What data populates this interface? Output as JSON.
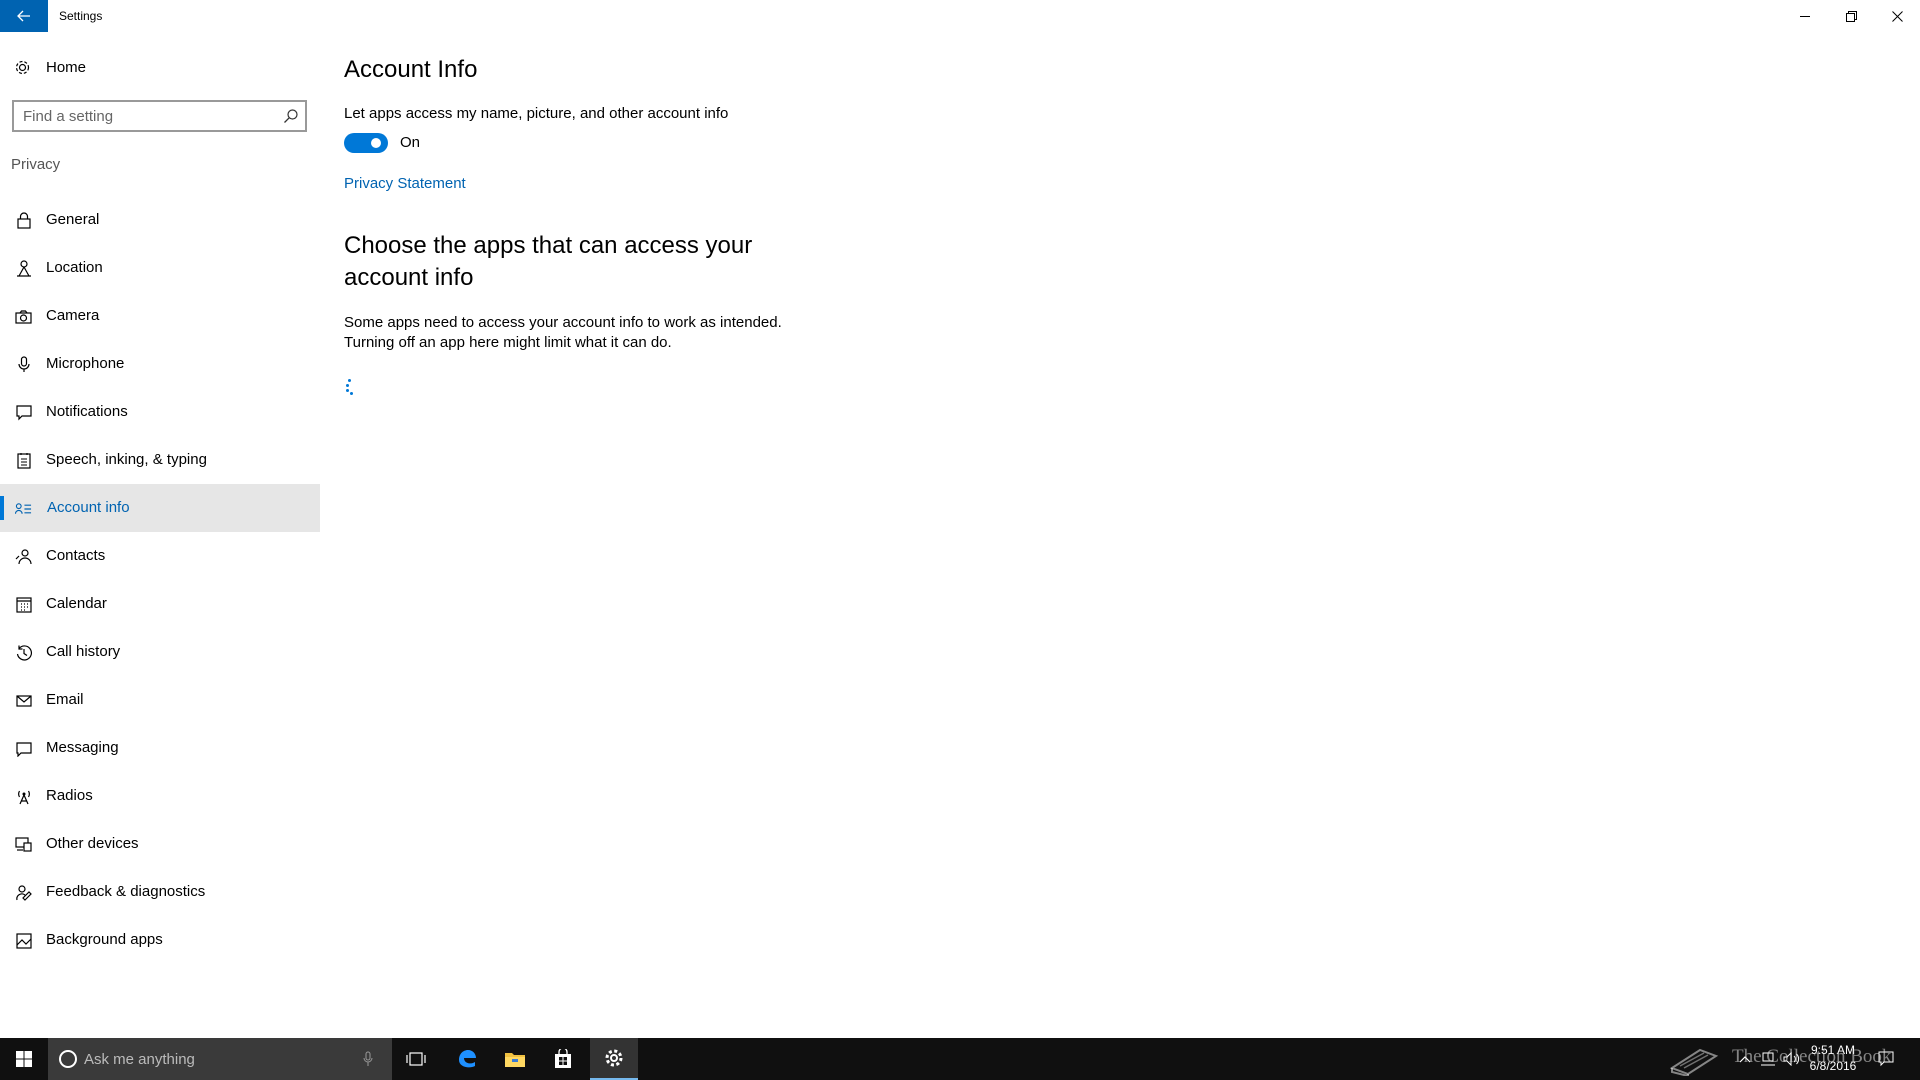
{
  "window": {
    "title": "Settings",
    "controls": {
      "minimize": "minimize",
      "maximize": "restore",
      "close": "close"
    }
  },
  "sidebar": {
    "home_label": "Home",
    "search": {
      "placeholder": "Find a setting"
    },
    "section_label": "Privacy",
    "items": [
      {
        "label": "General",
        "icon": "lock-icon",
        "selected": false
      },
      {
        "label": "Location",
        "icon": "location-icon",
        "selected": false
      },
      {
        "label": "Camera",
        "icon": "camera-icon",
        "selected": false
      },
      {
        "label": "Microphone",
        "icon": "microphone-icon",
        "selected": false
      },
      {
        "label": "Notifications",
        "icon": "notifications-icon",
        "selected": false
      },
      {
        "label": "Speech, inking, & typing",
        "icon": "speech-icon",
        "selected": false
      },
      {
        "label": "Account info",
        "icon": "account-info-icon",
        "selected": true
      },
      {
        "label": "Contacts",
        "icon": "contacts-icon",
        "selected": false
      },
      {
        "label": "Calendar",
        "icon": "calendar-icon",
        "selected": false
      },
      {
        "label": "Call history",
        "icon": "call-history-icon",
        "selected": false
      },
      {
        "label": "Email",
        "icon": "email-icon",
        "selected": false
      },
      {
        "label": "Messaging",
        "icon": "messaging-icon",
        "selected": false
      },
      {
        "label": "Radios",
        "icon": "radios-icon",
        "selected": false
      },
      {
        "label": "Other devices",
        "icon": "other-devices-icon",
        "selected": false
      },
      {
        "label": "Feedback & diagnostics",
        "icon": "feedback-icon",
        "selected": false
      },
      {
        "label": "Background apps",
        "icon": "background-apps-icon",
        "selected": false
      }
    ]
  },
  "main": {
    "title": "Account Info",
    "setting_description": "Let apps access my name, picture, and other account info",
    "toggle": {
      "on": true,
      "state_label": "On"
    },
    "privacy_link": "Privacy Statement",
    "apps_heading": "Choose the apps that can access your account info",
    "apps_description": "Some apps need to access your account info to work as intended. Turning off an app here might limit what it can do."
  },
  "taskbar": {
    "search_placeholder": "Ask me anything",
    "pinned": [
      "task-view",
      "edge",
      "file-explorer",
      "store",
      "settings"
    ],
    "clock": {
      "time": "9:51 AM",
      "date": "6/8/2016"
    }
  },
  "watermark": "The Collection Book",
  "colors": {
    "accent": "#0078d7",
    "accent_dark": "#0063b1",
    "selected_bg": "#e6e6e6",
    "taskbar_bg": "#101010"
  }
}
